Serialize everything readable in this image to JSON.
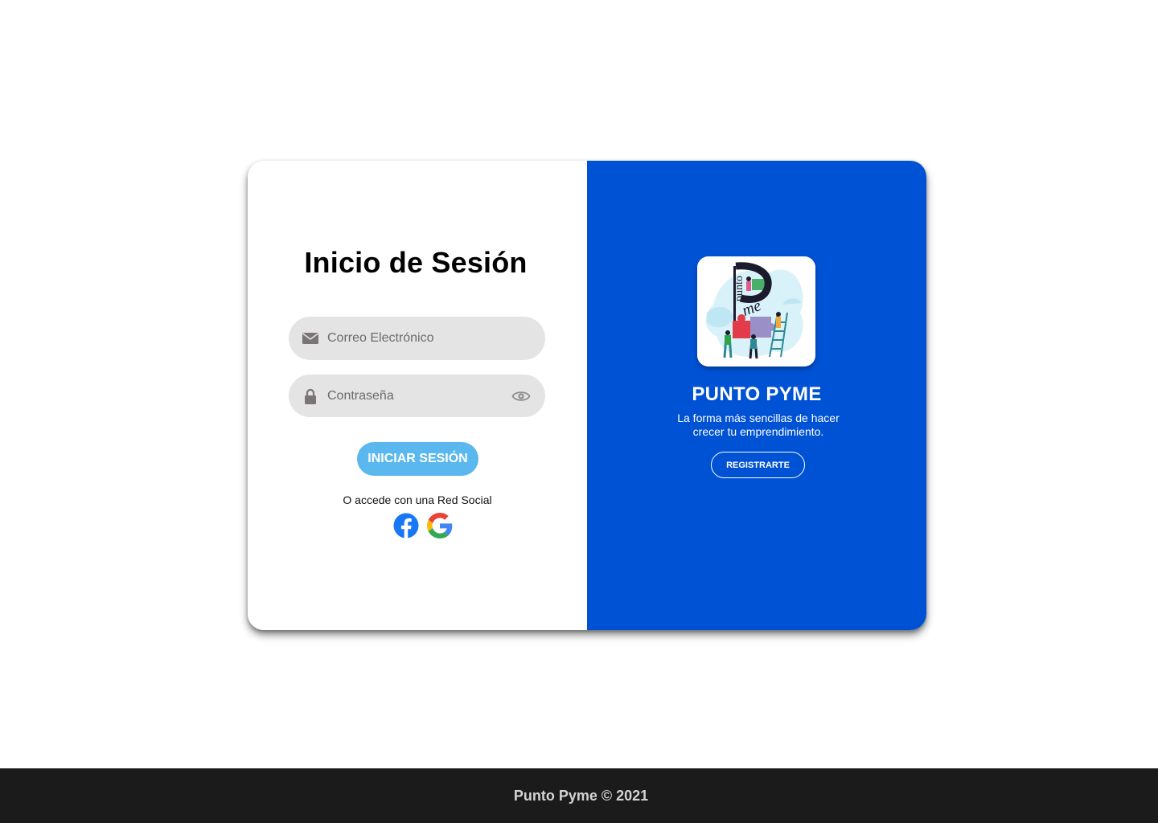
{
  "login": {
    "title": "Inicio de Sesión",
    "email_placeholder": "Correo Electrónico",
    "email_value": "",
    "password_placeholder": "Contraseña",
    "password_value": "",
    "submit_label": "INICIAR SESIÓN",
    "social_text": "O accede con una Red Social",
    "icons": {
      "email": "envelope-icon",
      "password": "lock-icon",
      "toggle": "eye-icon",
      "facebook": "facebook-icon",
      "google": "google-icon"
    }
  },
  "brand": {
    "logo_icon": "punto-pyme-logo",
    "title": "PUNTO PYME",
    "subtitle": "La forma más sencillas de hacer crecer tu emprendimiento.",
    "register_label": "REGISTRARTE"
  },
  "footer": {
    "text": "Punto Pyme © 2021"
  },
  "colors": {
    "brand_blue": "#0052d4",
    "button_blue": "#5ab8ee",
    "field_gray": "#e4e4e4",
    "footer_bg": "#1b1b1b"
  }
}
